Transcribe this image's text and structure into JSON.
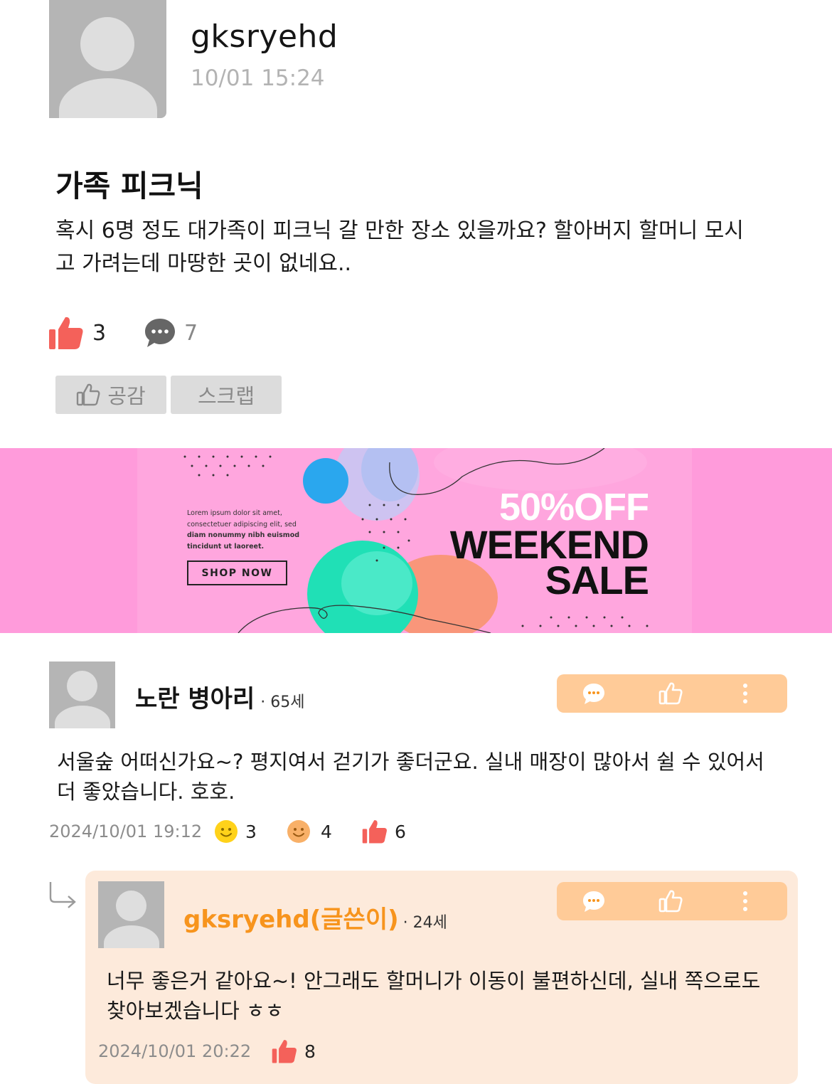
{
  "post": {
    "author": "gksryehd",
    "time": "10/01  15:24",
    "title": "가족 피크닉",
    "body_line1": "혹시 6명 정도 대가족이 피크닉 갈 만한 장소 있을까요? 할아버지 할머니 모시",
    "body_line2": "고 가려는데 마땅한 곳이 없네요..",
    "like_count": "3",
    "comment_count": "7",
    "empathize_label": "공감",
    "scrap_label": "스크랩"
  },
  "banner": {
    "lorem_line1": "Lorem ipsum dolor sit amet,",
    "lorem_line2": "consectetuer adipiscing elit, sed",
    "lorem_line3": "diam nonummy nibh euismod",
    "lorem_line4": "tincidunt ut laoreet.",
    "shop_now": "SHOP NOW",
    "discount": "50%OFF",
    "headline1": "WEEKEND",
    "headline2": "SALE",
    "background_color": "#ff9bdb"
  },
  "comments": [
    {
      "name": "노란 병아리",
      "age": "· 65세",
      "text_line1": "서울숲 어떠신가요~? 평지여서 걷기가 좋더군요. 실내 매장이 많아서 쉴 수 있어서",
      "text_line2": "더 좋았습니다. 호호.",
      "date": "2024/10/01  19:12",
      "smile_yellow_count": "3",
      "smile_orange_count": "4",
      "like_count": "6"
    }
  ],
  "reply": {
    "name": "gksryehd(글쓴이)",
    "age": "· 24세",
    "text_line1": "너무 좋은거 같아요~! 안그래도 할머니가 이동이 불편하신데, 실내 쪽으로도",
    "text_line2": "찾아보겠습니다 ㅎㅎ",
    "date": "2024/10/01  20:22",
    "like_count": "8"
  },
  "colors": {
    "accent_red": "#f4615a",
    "accent_orange": "#f7941d",
    "action_bar": "#ffcb98",
    "reply_bg": "#fdeadb"
  },
  "icons": [
    "thumbs-up-icon",
    "speech-bubble-icon",
    "smile-icon",
    "more-vertical-icon",
    "reply-arrow-icon"
  ]
}
